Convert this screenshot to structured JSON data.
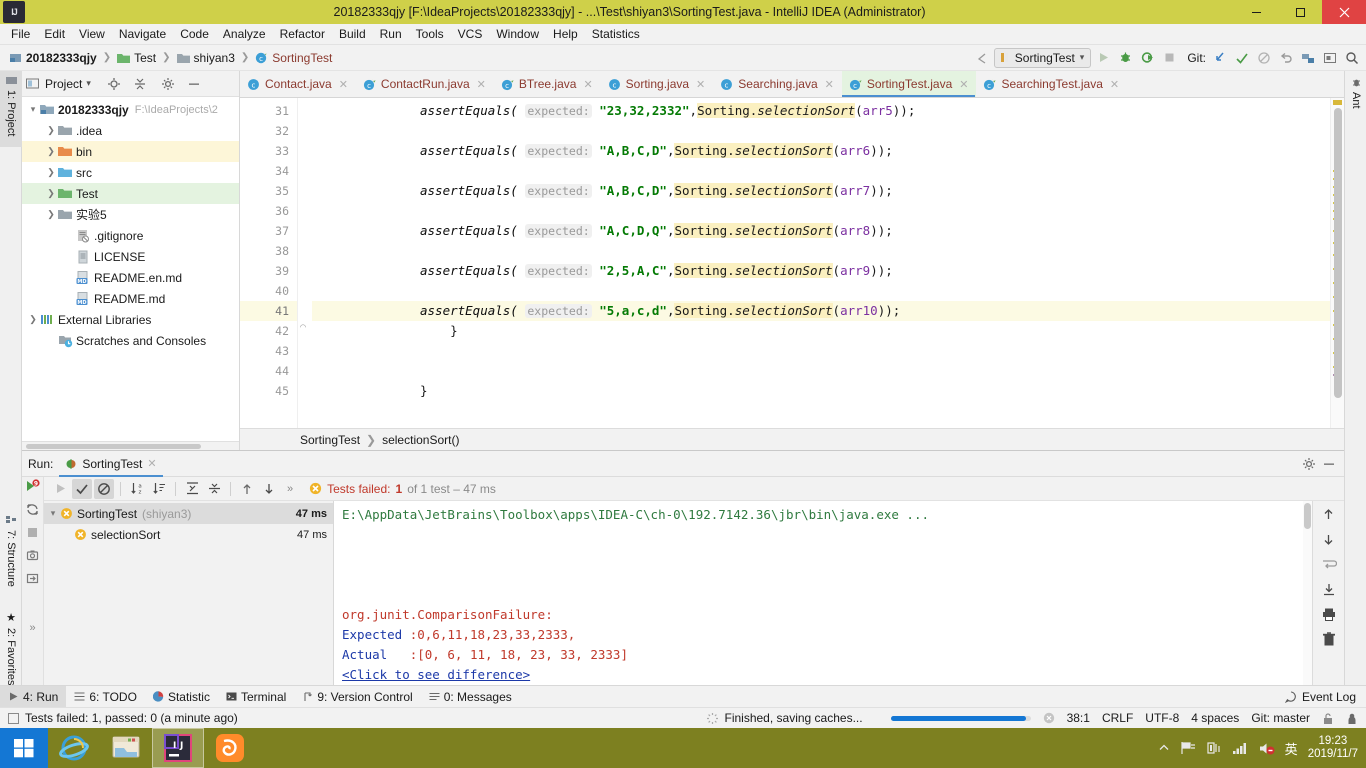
{
  "window": {
    "title": "20182333qjy [F:\\IdeaProjects\\20182333qjy] - ...\\Test\\shiyan3\\SortingTest.java - IntelliJ IDEA (Administrator)",
    "minimize": "–",
    "maximize": "❐",
    "close": "✕"
  },
  "menubar": {
    "items": [
      "File",
      "Edit",
      "View",
      "Navigate",
      "Code",
      "Analyze",
      "Refactor",
      "Build",
      "Run",
      "Tools",
      "VCS",
      "Window",
      "Help",
      "Statistics"
    ]
  },
  "navbar": {
    "breadcrumbs": [
      "20182333qjy",
      "Test",
      "shiyan3",
      "SortingTest"
    ],
    "run_config": "SortingTest",
    "git_label": "Git:"
  },
  "left_strip": {
    "project": "1: Project",
    "structure": "7: Structure",
    "favorites": "2: Favorites"
  },
  "right_strip": {
    "ant": "Ant"
  },
  "project_panel": {
    "title": "Project",
    "tree": [
      {
        "label": "20182333qjy",
        "path": "F:\\IdeaProjects\\2",
        "depth": 0,
        "arrow": "v",
        "icon": "module-icon",
        "bold": true,
        "highlight": ""
      },
      {
        "label": ".idea",
        "path": "",
        "depth": 1,
        "arrow": ">",
        "icon": "folder-gray-icon",
        "bold": false,
        "highlight": ""
      },
      {
        "label": "bin",
        "path": "",
        "depth": 1,
        "arrow": ">",
        "icon": "folder-orange-icon",
        "bold": false,
        "highlight": "bin"
      },
      {
        "label": "src",
        "path": "",
        "depth": 1,
        "arrow": ">",
        "icon": "folder-blue-icon",
        "bold": false,
        "highlight": ""
      },
      {
        "label": "Test",
        "path": "",
        "depth": 1,
        "arrow": ">",
        "icon": "folder-green-icon",
        "bold": false,
        "highlight": "test"
      },
      {
        "label": "实验5",
        "path": "",
        "depth": 1,
        "arrow": ">",
        "icon": "folder-gray-icon",
        "bold": false,
        "highlight": ""
      },
      {
        "label": ".gitignore",
        "path": "",
        "depth": 2,
        "arrow": "",
        "icon": "gitignore-icon",
        "bold": false,
        "highlight": ""
      },
      {
        "label": "LICENSE",
        "path": "",
        "depth": 2,
        "arrow": "",
        "icon": "file-icon",
        "bold": false,
        "highlight": ""
      },
      {
        "label": "README.en.md",
        "path": "",
        "depth": 2,
        "arrow": "",
        "icon": "markdown-icon",
        "bold": false,
        "highlight": ""
      },
      {
        "label": "README.md",
        "path": "",
        "depth": 2,
        "arrow": "",
        "icon": "markdown-icon",
        "bold": false,
        "highlight": ""
      },
      {
        "label": "External Libraries",
        "path": "",
        "depth": 0,
        "arrow": ">",
        "icon": "libraries-icon",
        "bold": false,
        "highlight": ""
      },
      {
        "label": "Scratches and Consoles",
        "path": "",
        "depth": 1,
        "arrow": "",
        "icon": "scratches-icon",
        "bold": false,
        "highlight": ""
      }
    ]
  },
  "editor": {
    "tabs": [
      {
        "label": "Contact.java",
        "icon": "class-icon",
        "active": false
      },
      {
        "label": "ContactRun.java",
        "icon": "class-run-icon",
        "active": false
      },
      {
        "label": "BTree.java",
        "icon": "class-run-icon",
        "active": false
      },
      {
        "label": "Sorting.java",
        "icon": "class-icon",
        "active": false
      },
      {
        "label": "Searching.java",
        "icon": "class-icon",
        "active": false
      },
      {
        "label": "SortingTest.java",
        "icon": "class-test-icon",
        "active": true
      },
      {
        "label": "SearchingTest.java",
        "icon": "class-test-icon",
        "active": false
      }
    ],
    "tab_close": "✕",
    "lines": [
      {
        "num": "31",
        "current": false,
        "indent": 8,
        "kind": "assert",
        "method": "assertEquals(",
        "hint": "expected:",
        "string": "\"23,32,2332\"",
        "call_cls": "Sorting.",
        "call_mth": "selectionSort",
        "arg": "arr5",
        "tail": "));"
      },
      {
        "num": "32",
        "current": false,
        "kind": "blank"
      },
      {
        "num": "33",
        "current": false,
        "indent": 8,
        "kind": "assert",
        "method": "assertEquals(",
        "hint": "expected:",
        "string": "\"A,B,C,D\"",
        "call_cls": "Sorting.",
        "call_mth": "selectionSort",
        "arg": "arr6",
        "tail": "));"
      },
      {
        "num": "34",
        "current": false,
        "kind": "blank"
      },
      {
        "num": "35",
        "current": false,
        "indent": 8,
        "kind": "assert",
        "method": "assertEquals(",
        "hint": "expected:",
        "string": "\"A,B,C,D\"",
        "call_cls": "Sorting.",
        "call_mth": "selectionSort",
        "arg": "arr7",
        "tail": "));"
      },
      {
        "num": "36",
        "current": false,
        "kind": "blank"
      },
      {
        "num": "37",
        "current": false,
        "indent": 8,
        "kind": "assert",
        "method": "assertEquals(",
        "hint": "expected:",
        "string": "\"A,C,D,Q\"",
        "call_cls": "Sorting.",
        "call_mth": "selectionSort",
        "arg": "arr8",
        "tail": "));"
      },
      {
        "num": "38",
        "current": false,
        "kind": "blank"
      },
      {
        "num": "39",
        "current": false,
        "indent": 8,
        "kind": "assert",
        "method": "assertEquals(",
        "hint": "expected:",
        "string": "\"2,5,A,C\"",
        "call_cls": "Sorting.",
        "call_mth": "selectionSort",
        "arg": "arr9",
        "tail": "));"
      },
      {
        "num": "40",
        "current": false,
        "kind": "blank"
      },
      {
        "num": "41",
        "current": true,
        "indent": 8,
        "kind": "assert",
        "method": "assertEquals(",
        "hint": "expected:",
        "string": "\"5,a,c,d\"",
        "call_cls": "Sorting.",
        "call_mth": "selectionSort",
        "arg": "arr10",
        "tail": "));"
      },
      {
        "num": "42",
        "current": false,
        "kind": "text",
        "text": "    }"
      },
      {
        "num": "43",
        "current": false,
        "kind": "blank"
      },
      {
        "num": "44",
        "current": false,
        "kind": "blank"
      },
      {
        "num": "45",
        "current": false,
        "kind": "text",
        "text": "}"
      }
    ],
    "breadcrumb": [
      "SortingTest",
      "selectionSort()"
    ]
  },
  "run_panel": {
    "label": "Run:",
    "tab": "SortingTest",
    "tab_close": "✕",
    "status": {
      "prefix": "Tests failed:",
      "count": "1",
      "suffix": "of 1 test – 47 ms"
    },
    "tree": [
      {
        "label": "SortingTest",
        "module": "(shiyan3)",
        "time": "47 ms",
        "depth": 0,
        "selected": true,
        "expander": "v"
      },
      {
        "label": "selectionSort",
        "module": "",
        "time": "47 ms",
        "depth": 1,
        "selected": false,
        "expander": ""
      }
    ],
    "console": [
      {
        "text": "E:\\AppData\\JetBrains\\Toolbox\\apps\\IDEA-C\\ch-0\\192.7142.36\\jbr\\bin\\java.exe ...",
        "cls": "cmd"
      },
      {
        "text": "",
        "cls": ""
      },
      {
        "text": "",
        "cls": ""
      },
      {
        "text": "",
        "cls": ""
      },
      {
        "text": "",
        "cls": ""
      },
      {
        "text": "org.junit.ComparisonFailure:",
        "cls": "err"
      },
      {
        "text": "Expected :0,6,11,18,23,33,2333,",
        "cls": "mixed-expected"
      },
      {
        "text": "Actual   :[0, 6, 11, 18, 23, 33, 2333]",
        "cls": "mixed-actual"
      },
      {
        "text": "<Click to see difference>",
        "cls": "link"
      }
    ],
    "console_expected_label": "Expected ",
    "console_expected_value": ":0,6,11,18,23,33,2333,",
    "console_actual_label": "Actual   ",
    "console_actual_value": ":[0, 6, 11, 18, 23, 33, 2333]"
  },
  "tool_buttons": [
    {
      "label": "4: Run",
      "icon": "run-icon",
      "selected": true
    },
    {
      "label": "6: TODO",
      "icon": "todo-icon",
      "selected": false
    },
    {
      "label": "Statistic",
      "icon": "statistic-icon",
      "selected": false
    },
    {
      "label": "Terminal",
      "icon": "terminal-icon",
      "selected": false
    },
    {
      "label": "9: Version Control",
      "icon": "vcs-icon",
      "selected": false
    },
    {
      "label": "0: Messages",
      "icon": "messages-icon",
      "selected": false
    }
  ],
  "event_log": "Event Log",
  "statusbar": {
    "message": "Tests failed: 1, passed: 0 (a minute ago)",
    "task": "Finished, saving caches...",
    "caret": "38:1",
    "line_sep": "CRLF",
    "encoding": "UTF-8",
    "indent": "4 spaces",
    "branch": "Git: master"
  },
  "taskbar": {
    "apps": [
      {
        "name": "internet-explorer",
        "active": false
      },
      {
        "name": "file-explorer",
        "active": false
      },
      {
        "name": "intellij-idea",
        "active": true
      },
      {
        "name": "uc-browser",
        "active": false
      }
    ],
    "ime": "英",
    "time": "19:23",
    "date": "2019/11/7"
  },
  "colors": {
    "title_bar": "#cfd049",
    "accent": "#1477d4",
    "fail": "#c0392b",
    "taskbar": "#7d8020",
    "active_tab": "#e4f3e0"
  }
}
